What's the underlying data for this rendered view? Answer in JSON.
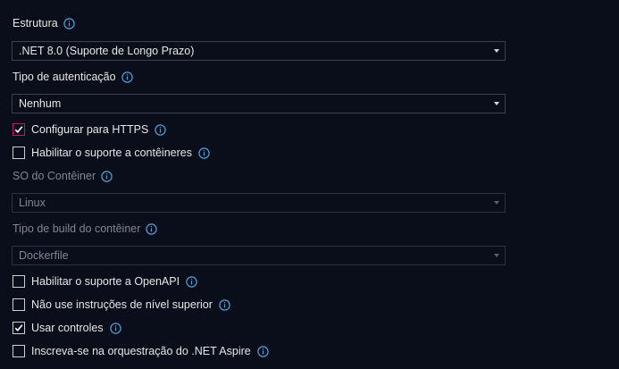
{
  "framework": {
    "label": "Estrutura",
    "value": ".NET 8.0 (Suporte de Longo Prazo)"
  },
  "auth": {
    "label": "Tipo de autenticação",
    "value": "Nenhum"
  },
  "https": {
    "label": "Configurar para HTTPS",
    "checked": true
  },
  "containers": {
    "label": "Habilitar o suporte a contêineres",
    "checked": false
  },
  "container_os": {
    "label": "SO do Contêiner",
    "value": "Linux"
  },
  "container_build": {
    "label": "Tipo de build do contêiner",
    "value": "Dockerfile"
  },
  "openapi": {
    "label": "Habilitar o suporte a OpenAPI",
    "checked": false
  },
  "top_level": {
    "label": "Não use instruções de nível superior",
    "checked": false
  },
  "controllers": {
    "label": "Usar controles",
    "checked": true
  },
  "aspire": {
    "label": "Inscreva-se na orquestração do .NET Aspire",
    "checked": false
  },
  "colors": {
    "info": "#4aa3e0",
    "background": "#0a0e1a",
    "focus": "#c2185b"
  }
}
